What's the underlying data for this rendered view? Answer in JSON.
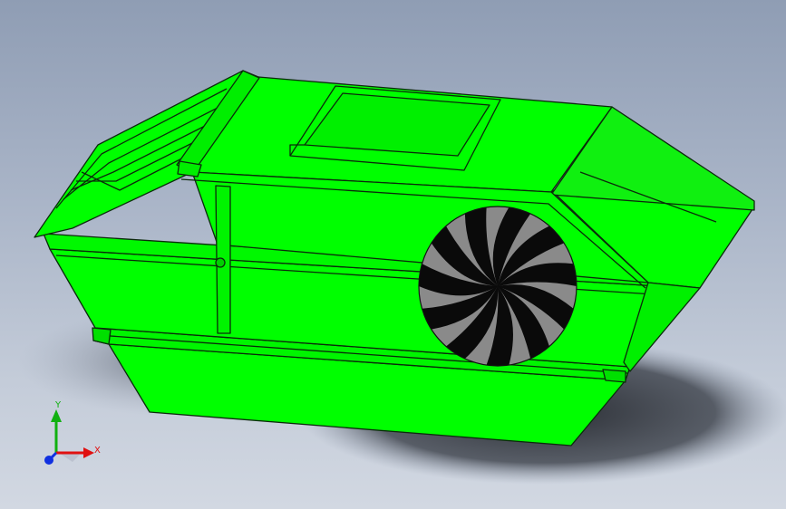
{
  "colors": {
    "background_top": "#8f9db4",
    "background_bottom": "#d2d8e2",
    "body_fill": "#00ff00",
    "body_shade": "#1ee81e",
    "edge": "#0b2a0b",
    "shadow": "#2b2f36",
    "wheel_dark": "#0a0a0a",
    "wheel_light": "#8a8a8a",
    "axis_x": "#e01010",
    "axis_y": "#10b010",
    "axis_z": "#1030e0"
  },
  "triad": {
    "x_label": "X",
    "y_label": "Y"
  },
  "model": {
    "wheel": {
      "spokes": 22
    }
  }
}
